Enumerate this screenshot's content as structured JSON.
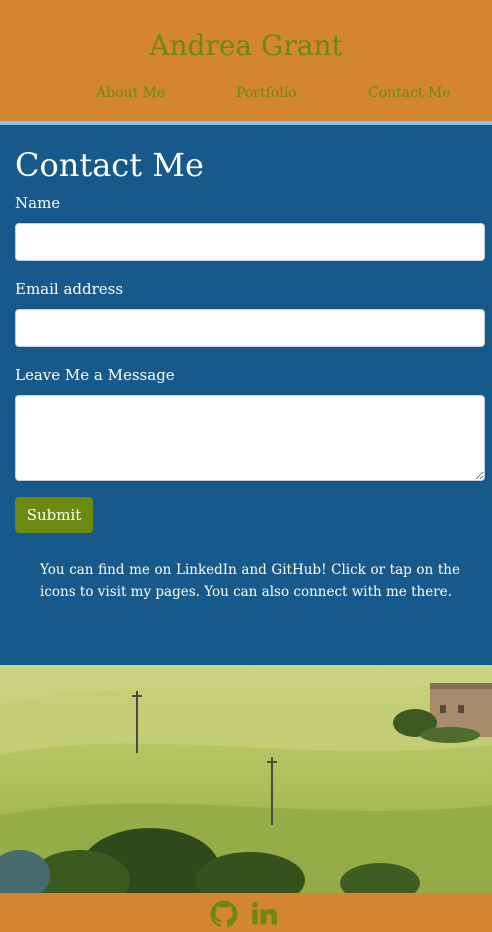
{
  "site": {
    "title": "Andrea Grant",
    "nav": [
      {
        "label": "About Me"
      },
      {
        "label": "Portfolio"
      },
      {
        "label": "Contact Me"
      }
    ]
  },
  "contact": {
    "heading": "Contact Me",
    "name_label": "Name",
    "name_value": "",
    "email_label": "Email address",
    "email_value": "",
    "message_label": "Leave Me a Message",
    "message_value": "",
    "submit_label": "Submit",
    "note": "You can find me on LinkedIn and GitHub! Click or tap on the icons to visit my pages. You can also connect with me there."
  },
  "footer": {
    "icons": [
      "github-icon",
      "linkedin-icon"
    ]
  },
  "colors": {
    "header_bg": "#d48530",
    "accent_green": "#6c8a10",
    "main_bg": "#17598a",
    "divider": "#8fc3ec"
  }
}
